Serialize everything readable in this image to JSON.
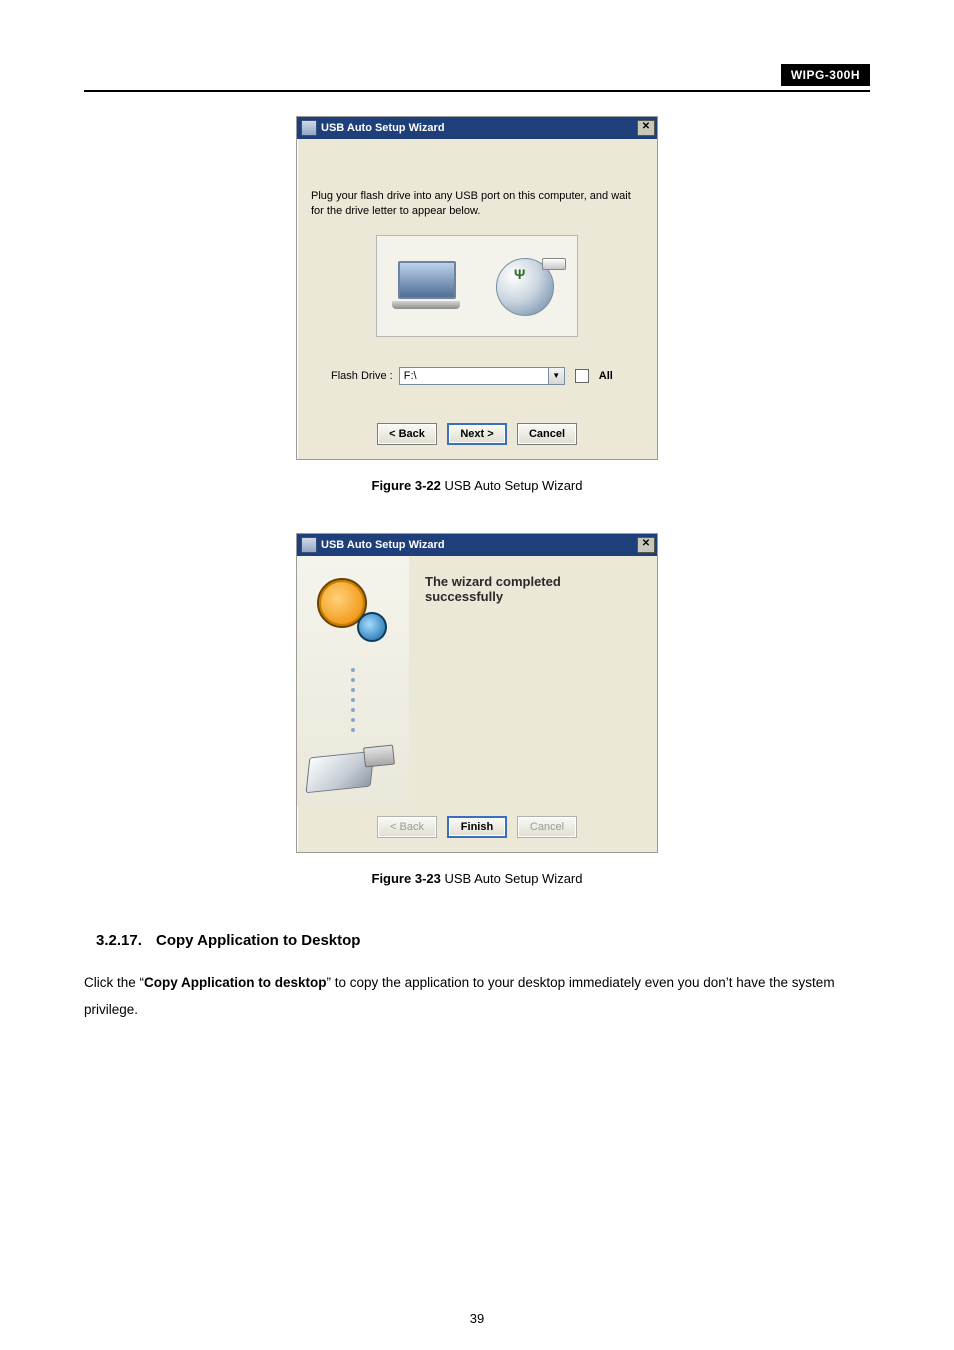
{
  "header": {
    "product": "WIPG-300H"
  },
  "wizard1": {
    "title": "USB Auto Setup Wizard",
    "instruction": "Plug your flash drive into any USB port on this computer, and wait for the drive letter to appear below.",
    "flash_drive_label": "Flash Drive :",
    "flash_drive_value": "F:\\",
    "all_label": "All",
    "buttons": {
      "back": "< Back",
      "next": "Next >",
      "cancel": "Cancel"
    }
  },
  "caption1": {
    "bold": "Figure 3-22",
    "text": " USB Auto Setup Wizard"
  },
  "wizard2": {
    "title": "USB Auto Setup Wizard",
    "completed_heading": "The wizard completed successfully",
    "buttons": {
      "back": "< Back",
      "finish": "Finish",
      "cancel": "Cancel"
    }
  },
  "caption2": {
    "bold": "Figure 3-23",
    "text": " USB Auto Setup Wizard"
  },
  "section": {
    "number": "3.2.17.",
    "title": "Copy Application to Desktop",
    "body_pre": "Click the “",
    "body_bold": "Copy Application to desktop",
    "body_post": "” to copy the application to your desktop immediately even you don’t have the system privilege."
  },
  "page_number": "39"
}
